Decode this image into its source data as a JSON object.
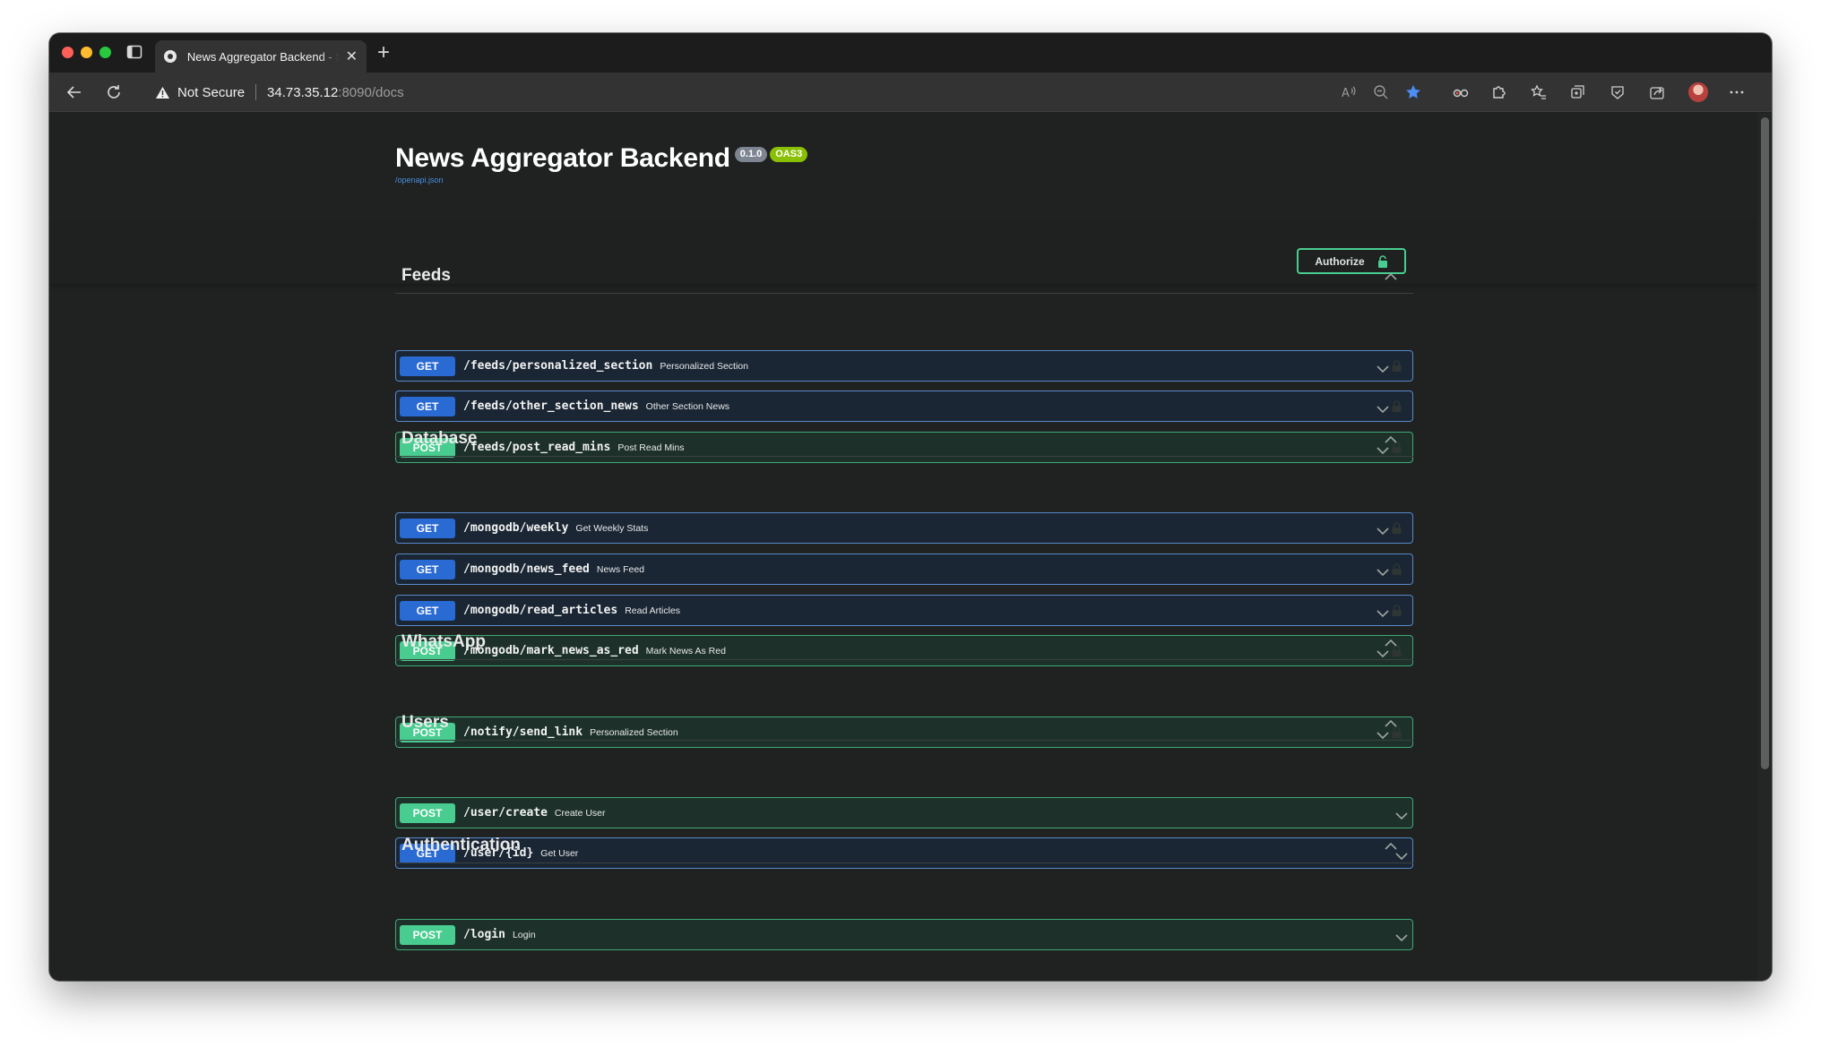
{
  "browser": {
    "tab": {
      "title": "News Aggregator Backend - Swagger UI",
      "close_glyph": "✕"
    },
    "new_tab_glyph": "+",
    "address": {
      "security_label": "Not Secure",
      "host": "34.73.35.12",
      "path": ":8090/docs"
    }
  },
  "api": {
    "title": "News Aggregator Backend",
    "version": "0.1.0",
    "oas_badge": "OAS3",
    "spec_link": "/openapi.json",
    "authorize_label": "Authorize"
  },
  "colors": {
    "get": "#2a6ad3",
    "post": "#49cc90",
    "background": "#1f2221"
  },
  "tags": [
    {
      "name": "Feeds",
      "operations": [
        {
          "method": "GET",
          "path": "/feeds/personalized_section",
          "summary": "Personalized Section",
          "locked": true
        },
        {
          "method": "GET",
          "path": "/feeds/other_section_news",
          "summary": "Other Section News",
          "locked": true
        },
        {
          "method": "POST",
          "path": "/feeds/post_read_mins",
          "summary": "Post Read Mins",
          "locked": true
        }
      ]
    },
    {
      "name": "Database",
      "operations": [
        {
          "method": "GET",
          "path": "/mongodb/weekly",
          "summary": "Get Weekly Stats",
          "locked": true
        },
        {
          "method": "GET",
          "path": "/mongodb/news_feed",
          "summary": "News Feed",
          "locked": true
        },
        {
          "method": "GET",
          "path": "/mongodb/read_articles",
          "summary": "Read Articles",
          "locked": true
        },
        {
          "method": "POST",
          "path": "/mongodb/mark_news_as_red",
          "summary": "Mark News As Red",
          "locked": true
        }
      ]
    },
    {
      "name": "WhatsApp",
      "operations": [
        {
          "method": "POST",
          "path": "/notify/send_link",
          "summary": "Personalized Section",
          "locked": true
        }
      ]
    },
    {
      "name": "Users",
      "operations": [
        {
          "method": "POST",
          "path": "/user/create",
          "summary": "Create User",
          "locked": false
        },
        {
          "method": "GET",
          "path": "/user/{id}",
          "summary": "Get User",
          "locked": false
        }
      ]
    },
    {
      "name": "Authentication",
      "operations": [
        {
          "method": "POST",
          "path": "/login",
          "summary": "Login",
          "locked": false
        }
      ]
    }
  ]
}
